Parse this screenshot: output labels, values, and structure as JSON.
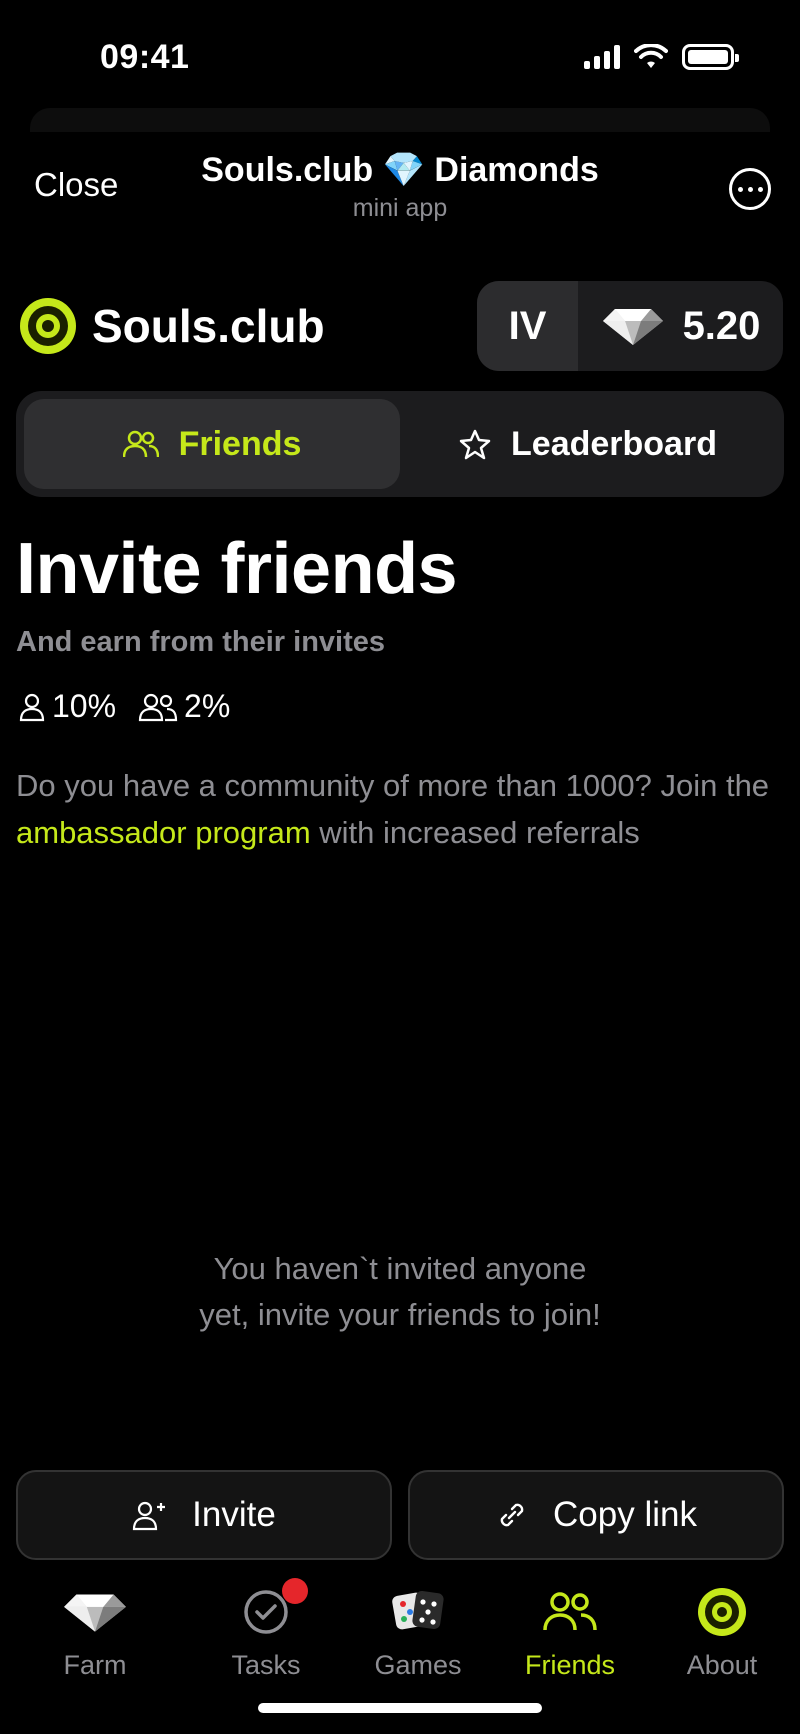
{
  "status_bar": {
    "time": "09:41"
  },
  "header": {
    "close_label": "Close",
    "title": "Souls.club 💎 Diamonds",
    "subtitle": "mini app"
  },
  "brand": {
    "name": "Souls.club",
    "level": "IV",
    "balance": "5.20"
  },
  "tabs": [
    {
      "label": "Friends",
      "icon": "users-icon",
      "active": true
    },
    {
      "label": "Leaderboard",
      "icon": "star-icon",
      "active": false
    }
  ],
  "invite": {
    "title": "Invite friends",
    "subtitle": "And earn from their invites",
    "rate_level1": "10%",
    "rate_level2": "2%",
    "desc_before": "Do you have a community of more than 1000? Join the ",
    "desc_link": "ambassador program",
    "desc_after": " with increased referrals",
    "empty_line1": "You haven`t invited anyone",
    "empty_line2": "yet, invite your friends to join!"
  },
  "actions": {
    "invite_label": "Invite",
    "copy_label": "Copy link"
  },
  "nav": [
    {
      "label": "Farm",
      "icon": "diamond-icon"
    },
    {
      "label": "Tasks",
      "icon": "check-circle-icon"
    },
    {
      "label": "Games",
      "icon": "dice-icon"
    },
    {
      "label": "Friends",
      "icon": "users-icon",
      "active": true
    },
    {
      "label": "About",
      "icon": "target-icon"
    }
  ],
  "colors": {
    "accent": "#c5e81a",
    "background": "#000000",
    "panel": "#1c1c1e",
    "muted": "#8e8e93",
    "badge": "#e5262b"
  }
}
